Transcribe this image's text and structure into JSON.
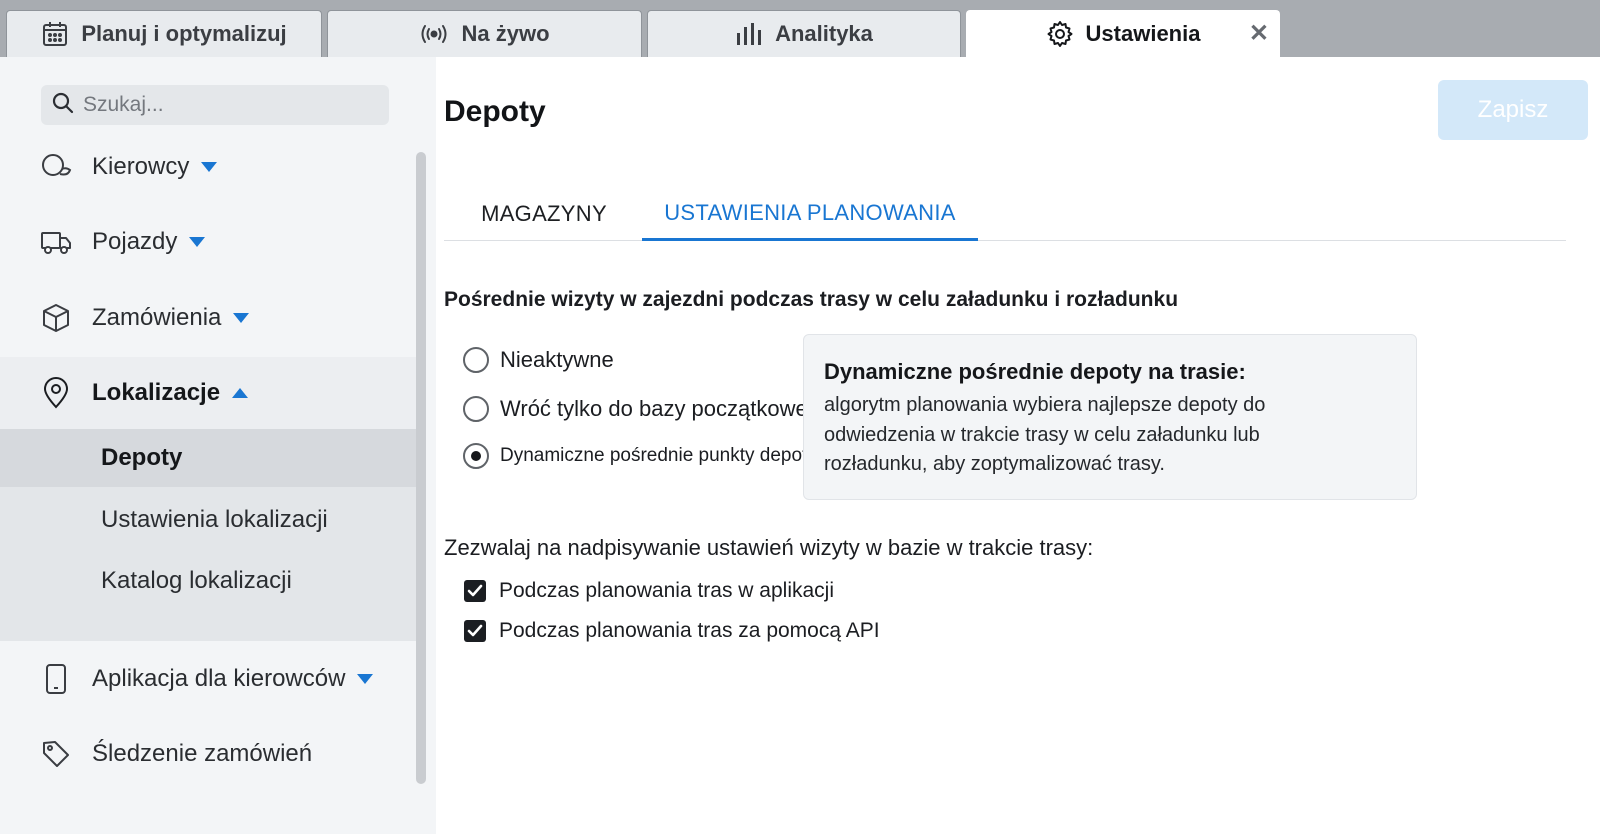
{
  "top_tabs": [
    {
      "label": "Planuj i optymalizuj",
      "icon": "calendar-icon"
    },
    {
      "label": "Na żywo",
      "icon": "live-broadcast-icon"
    },
    {
      "label": "Analityka",
      "icon": "bar-chart-icon"
    },
    {
      "label": "Ustawienia",
      "icon": "gear-icon",
      "active": true
    }
  ],
  "close_glyph": "✕",
  "sidebar": {
    "search_placeholder": "Szukaj...",
    "items": [
      {
        "label": "Kierowcy",
        "icon": "drivers-icon",
        "expanded": false
      },
      {
        "label": "Pojazdy",
        "icon": "truck-icon",
        "expanded": false
      },
      {
        "label": "Zamówienia",
        "icon": "package-icon",
        "expanded": false
      },
      {
        "label": "Lokalizacje",
        "icon": "location-pin-icon",
        "expanded": true
      },
      {
        "label": "Aplikacja dla kierowców",
        "icon": "phone-icon",
        "expanded": false
      },
      {
        "label": "Śledzenie zamówień",
        "icon": "tag-icon",
        "expanded": false
      }
    ],
    "sub_items": [
      {
        "label": "Depoty",
        "active": true
      },
      {
        "label": "Ustawienia lokalizacji"
      },
      {
        "label": "Katalog lokalizacji"
      }
    ]
  },
  "main": {
    "title": "Depoty",
    "save_label": "Zapisz",
    "tabs": [
      {
        "label": "MAGAZYNY"
      },
      {
        "label": "USTAWIENIA PLANOWANIA",
        "active": true
      }
    ],
    "section1_title": "Pośrednie wizyty w zajezdni podczas trasy w celu załadunku i rozładunku",
    "radio_options": [
      {
        "label": "Nieaktywne",
        "checked": false
      },
      {
        "label": "Wróć tylko do bazy początkowej",
        "checked": false
      },
      {
        "label": "Dynamiczne pośrednie punkty depotu",
        "checked": true
      }
    ],
    "info_box": {
      "title": "Dynamiczne pośrednie depoty na trasie:",
      "text": "algorytm planowania wybiera najlepsze depoty do odwiedzenia w trakcie trasy w celu załadunku lub rozładunku, aby zoptymalizować trasy."
    },
    "section2_label": "Zezwalaj na nadpisywanie ustawień wizyty w bazie w trakcie trasy:",
    "checkboxes": [
      {
        "label": "Podczas planowania tras w aplikacji",
        "checked": true
      },
      {
        "label": "Podczas planowania tras za pomocą API",
        "checked": true
      }
    ]
  },
  "colors": {
    "accent": "#1976d2",
    "save_disabled_bg": "#d3e8f9",
    "sidebar_bg": "#f3f5f7",
    "topbar_bg": "#a8acb1"
  }
}
